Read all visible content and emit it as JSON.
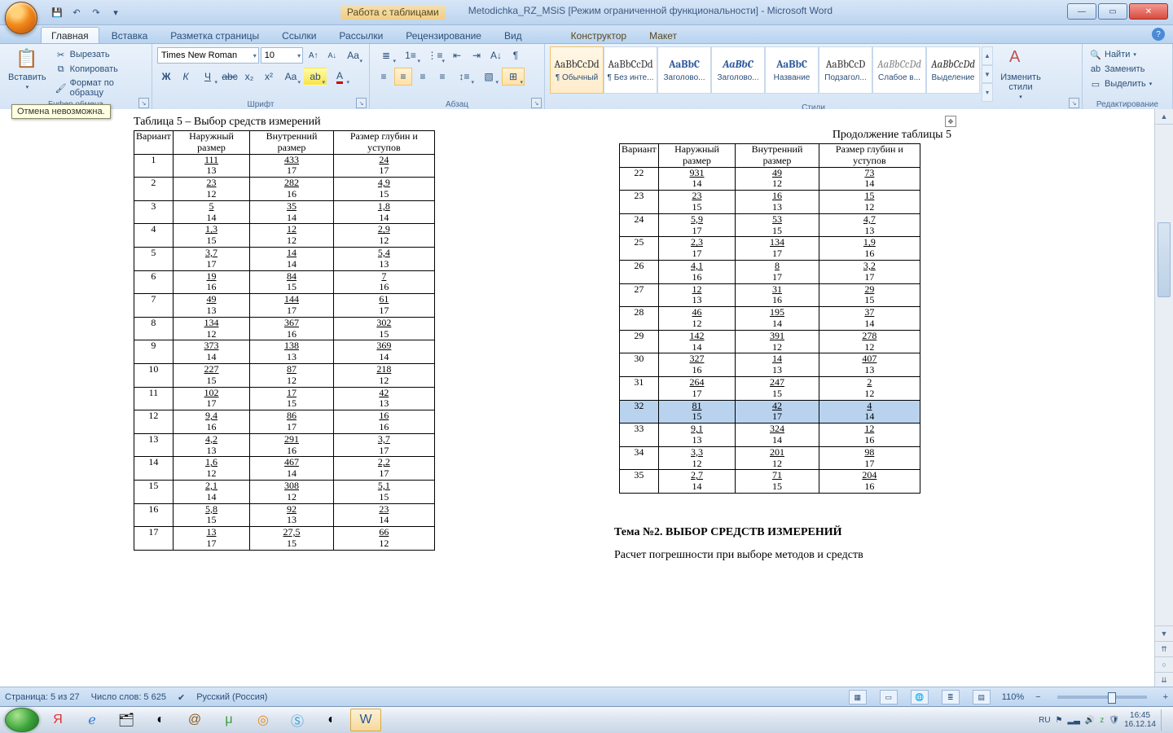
{
  "title": {
    "tools_label": "Работа с таблицами",
    "doc": "Metodichka_RZ_MSiS [Режим ограниченной функциональности] - Microsoft Word"
  },
  "tabs": {
    "home": "Главная",
    "insert": "Вставка",
    "layout": "Разметка страницы",
    "refs": "Ссылки",
    "mail": "Рассылки",
    "review": "Рецензирование",
    "view": "Вид",
    "design": "Конструктор",
    "tlayout": "Макет"
  },
  "ribbon": {
    "clipboard": {
      "paste": "Вставить",
      "cut": "Вырезать",
      "copy": "Копировать",
      "format_painter": "Формат по образцу",
      "group": "Буфер обмена"
    },
    "font": {
      "name": "Times New Roman",
      "size": "10",
      "group": "Шрифт"
    },
    "paragraph": {
      "group": "Абзац"
    },
    "styles": {
      "group": "Стили",
      "change": "Изменить стили",
      "items": [
        {
          "sample": "AaBbCcDd",
          "name": "¶ Обычный"
        },
        {
          "sample": "AaBbCcDd",
          "name": "¶ Без инте..."
        },
        {
          "sample": "AaBbC",
          "name": "Заголово..."
        },
        {
          "sample": "AaBbC",
          "name": "Заголово..."
        },
        {
          "sample": "AaBbC",
          "name": "Название"
        },
        {
          "sample": "AaBbCcD",
          "name": "Подзагол..."
        },
        {
          "sample": "AaBbCcDd",
          "name": "Слабое в..."
        },
        {
          "sample": "AaBbCcDd",
          "name": "Выделение"
        }
      ]
    },
    "editing": {
      "find": "Найти",
      "replace": "Заменить",
      "select": "Выделить",
      "group": "Редактирование"
    }
  },
  "tooltip": "Отмена невозможна.",
  "doc": {
    "left_title": "Таблица 5 – Выбор средств измерений",
    "right_title": "Продолжение таблицы 5",
    "headers": [
      "Вариант",
      "Наружный размер",
      "Внутренний размер",
      "Размер глубин и уступов"
    ],
    "left_rows": [
      {
        "v": "1",
        "a": [
          "111",
          "13"
        ],
        "b": [
          "433",
          "17"
        ],
        "c": [
          "24",
          "17"
        ]
      },
      {
        "v": "2",
        "a": [
          "23",
          "12"
        ],
        "b": [
          "282",
          "16"
        ],
        "c": [
          "4,9",
          "15"
        ]
      },
      {
        "v": "3",
        "a": [
          "5",
          "14"
        ],
        "b": [
          "35",
          "14"
        ],
        "c": [
          "1,8",
          "14"
        ]
      },
      {
        "v": "4",
        "a": [
          "1,3",
          "15"
        ],
        "b": [
          "12",
          "12"
        ],
        "c": [
          "2,9",
          "12"
        ]
      },
      {
        "v": "5",
        "a": [
          "3,7",
          "17"
        ],
        "b": [
          "14",
          "14"
        ],
        "c": [
          "5,4",
          "13"
        ]
      },
      {
        "v": "6",
        "a": [
          "19",
          "16"
        ],
        "b": [
          "84",
          "15"
        ],
        "c": [
          "7",
          "16"
        ]
      },
      {
        "v": "7",
        "a": [
          "49",
          "13"
        ],
        "b": [
          "144",
          "17"
        ],
        "c": [
          "61",
          "17"
        ]
      },
      {
        "v": "8",
        "a": [
          "134",
          "12"
        ],
        "b": [
          "367",
          "16"
        ],
        "c": [
          "302",
          "15"
        ]
      },
      {
        "v": "9",
        "a": [
          "373",
          "14"
        ],
        "b": [
          "138",
          "13"
        ],
        "c": [
          "369",
          "14"
        ]
      },
      {
        "v": "10",
        "a": [
          "227",
          "15"
        ],
        "b": [
          "87",
          "12"
        ],
        "c": [
          "218",
          "12"
        ]
      },
      {
        "v": "11",
        "a": [
          "102",
          "17"
        ],
        "b": [
          "17",
          "15"
        ],
        "c": [
          "42",
          "13"
        ]
      },
      {
        "v": "12",
        "a": [
          "9,4",
          "16"
        ],
        "b": [
          "86",
          "17"
        ],
        "c": [
          "16",
          "16"
        ]
      },
      {
        "v": "13",
        "a": [
          "4,2",
          "13"
        ],
        "b": [
          "291",
          "16"
        ],
        "c": [
          "3,7",
          "17"
        ]
      },
      {
        "v": "14",
        "a": [
          "1,6",
          "12"
        ],
        "b": [
          "467",
          "14"
        ],
        "c": [
          "2,2",
          "17"
        ]
      },
      {
        "v": "15",
        "a": [
          "2,1",
          "14"
        ],
        "b": [
          "308",
          "12"
        ],
        "c": [
          "5,1",
          "15"
        ]
      },
      {
        "v": "16",
        "a": [
          "5,8",
          "15"
        ],
        "b": [
          "92",
          "13"
        ],
        "c": [
          "23",
          "14"
        ]
      },
      {
        "v": "17",
        "a": [
          "13",
          "17"
        ],
        "b": [
          "27,5",
          "15"
        ],
        "c": [
          "66",
          "12"
        ]
      }
    ],
    "right_rows": [
      {
        "v": "22",
        "a": [
          "931",
          "14"
        ],
        "b": [
          "49",
          "12"
        ],
        "c": [
          "73",
          "14"
        ]
      },
      {
        "v": "23",
        "a": [
          "23",
          "15"
        ],
        "b": [
          "16",
          "13"
        ],
        "c": [
          "15",
          "12"
        ]
      },
      {
        "v": "24",
        "a": [
          "5,9",
          "17"
        ],
        "b": [
          "53",
          "15"
        ],
        "c": [
          "4,7",
          "13"
        ]
      },
      {
        "v": "25",
        "a": [
          "2,3",
          "17"
        ],
        "b": [
          "134",
          "17"
        ],
        "c": [
          "1,9",
          "16"
        ]
      },
      {
        "v": "26",
        "a": [
          "4,1",
          "16"
        ],
        "b": [
          "8",
          "17"
        ],
        "c": [
          "3,2",
          "17"
        ]
      },
      {
        "v": "27",
        "a": [
          "12",
          "13"
        ],
        "b": [
          "31",
          "16"
        ],
        "c": [
          "29",
          "15"
        ]
      },
      {
        "v": "28",
        "a": [
          "46",
          "12"
        ],
        "b": [
          "195",
          "14"
        ],
        "c": [
          "37",
          "14"
        ]
      },
      {
        "v": "29",
        "a": [
          "142",
          "14"
        ],
        "b": [
          "391",
          "12"
        ],
        "c": [
          "278",
          "12"
        ]
      },
      {
        "v": "30",
        "a": [
          "327",
          "16"
        ],
        "b": [
          "14",
          "13"
        ],
        "c": [
          "407",
          "13"
        ]
      },
      {
        "v": "31",
        "a": [
          "264",
          "17"
        ],
        "b": [
          "247",
          "15"
        ],
        "c": [
          "2",
          "12"
        ]
      },
      {
        "v": "32",
        "a": [
          "81",
          "15"
        ],
        "b": [
          "42",
          "17"
        ],
        "c": [
          "4",
          "14"
        ],
        "hl": true
      },
      {
        "v": "33",
        "a": [
          "9,1",
          "13"
        ],
        "b": [
          "324",
          "14"
        ],
        "c": [
          "12",
          "16"
        ]
      },
      {
        "v": "34",
        "a": [
          "3,3",
          "12"
        ],
        "b": [
          "201",
          "12"
        ],
        "c": [
          "98",
          "17"
        ]
      },
      {
        "v": "35",
        "a": [
          "2,7",
          "14"
        ],
        "b": [
          "71",
          "15"
        ],
        "c": [
          "204",
          "16"
        ]
      }
    ],
    "theme_label": "Тема №2.",
    "theme_title": "ВЫБОР СРЕДСТВ ИЗМЕРЕНИЙ",
    "body": "Расчет   погрешности   при   выборе   методов   и   средств"
  },
  "status": {
    "page": "Страница: 5 из 27",
    "words": "Число слов: 5 625",
    "lang": "Русский (Россия)",
    "zoom": "110%"
  },
  "tray": {
    "kbd": "RU",
    "time": "16:45",
    "date": "16.12.14"
  }
}
